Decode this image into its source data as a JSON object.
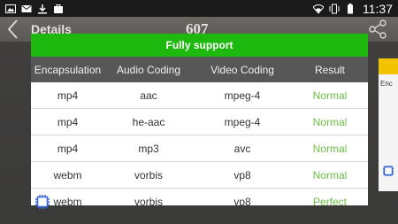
{
  "status_bar": {
    "time": "11:37",
    "left_icons": [
      "image-icon",
      "gmail-icon",
      "download-icon",
      "bag-icon"
    ],
    "right_icons": [
      "wifi-icon",
      "vibrate-icon",
      "battery-icon"
    ]
  },
  "app_bar": {
    "title": "Details",
    "number": "607",
    "back_icon": "back-icon",
    "share_icon": "share-icon"
  },
  "side_card": {
    "text": "Enc"
  },
  "dialog": {
    "title": "Fully support",
    "columns": [
      "Encapsulation",
      "Audio Coding",
      "Video Coding",
      "Result"
    ],
    "rows": [
      {
        "encapsulation": "mp4",
        "audio": "aac",
        "video": "mpeg-4",
        "result": "Normal"
      },
      {
        "encapsulation": "mp4",
        "audio": "he-aac",
        "video": "mpeg-4",
        "result": "Normal"
      },
      {
        "encapsulation": "mp4",
        "audio": "mp3",
        "video": "avc",
        "result": "Normal"
      },
      {
        "encapsulation": "webm",
        "audio": "vorbis",
        "video": "vp8",
        "result": "Normal"
      },
      {
        "encapsulation": "webm",
        "audio": "vorbis",
        "video": "vp8",
        "result": "Perfect"
      }
    ]
  },
  "colors": {
    "header_green": "#1eb90f",
    "table_header": "#575757",
    "result_green": "#6bc046",
    "chip_blue": "#3a66d6",
    "side_strip": "#f2c400"
  }
}
